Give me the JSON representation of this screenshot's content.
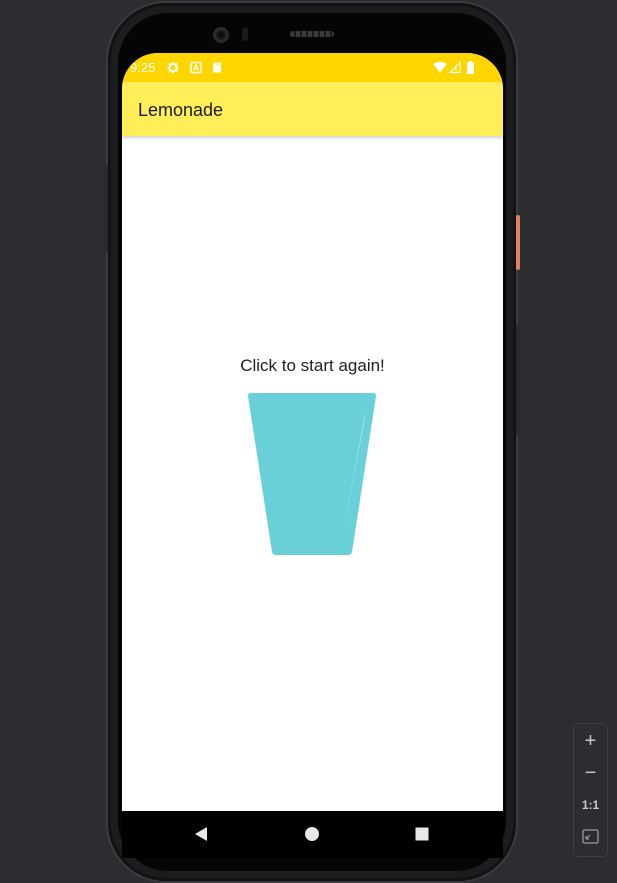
{
  "status_bar": {
    "time": "9:25",
    "icons": [
      "settings-icon",
      "text-a-icon",
      "sd-card-icon",
      "wifi-icon",
      "signal-icon",
      "battery-icon"
    ],
    "color": "#ffd600"
  },
  "app_bar": {
    "title": "Lemonade",
    "color": "#ffee58"
  },
  "main": {
    "prompt": "Click to start again!",
    "image": "empty-glass-icon",
    "glass_color": "#69cfd9"
  },
  "nav_bar": {
    "buttons": [
      "back-icon",
      "home-icon",
      "recents-icon"
    ]
  },
  "zoom_controls": {
    "zoom_in": "+",
    "zoom_out": "−",
    "actual_size": "1:1",
    "fit_icon": "fit-screen-icon"
  }
}
